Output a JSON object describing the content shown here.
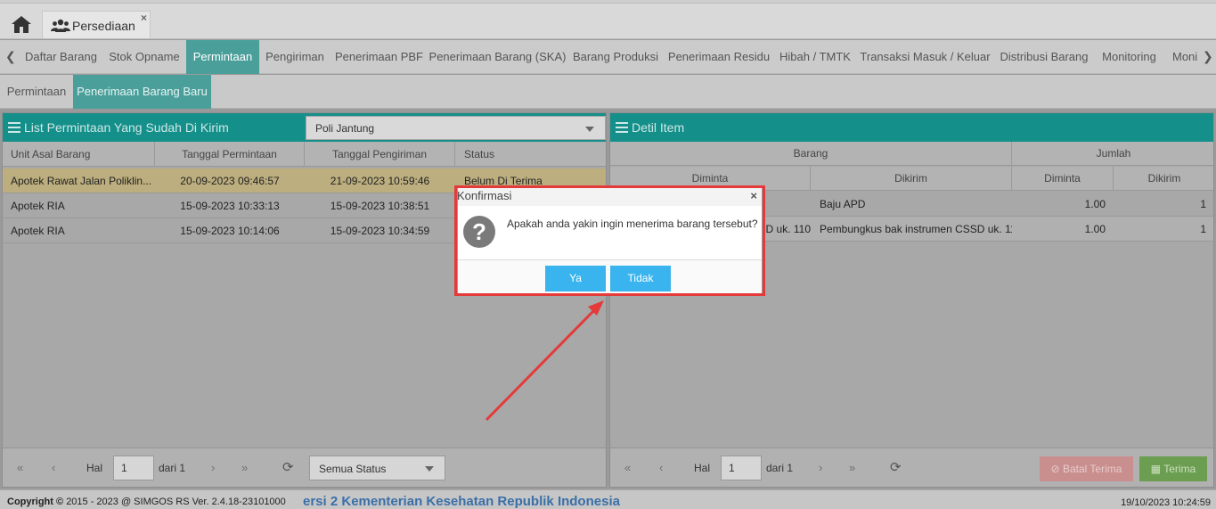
{
  "top": {
    "tab_label": "Persediaan",
    "tab_close": "×"
  },
  "modules": [
    "Daftar Barang",
    "Stok Opname",
    "Permintaan",
    "Pengiriman",
    "Penerimaan PBF",
    "Penerimaan Barang (SKA)",
    "Barang Produksi",
    "Penerimaan Residu",
    "Hibah / TMTK",
    "Transaksi Masuk / Keluar",
    "Distribusi Barang",
    "Monitoring",
    "Moni"
  ],
  "subtabs": [
    "Permintaan",
    "Penerimaan Barang Baru"
  ],
  "left_panel": {
    "title": "List Permintaan Yang Sudah Di Kirim",
    "filter_value": "Poli Jantung",
    "columns": [
      "Unit Asal Barang",
      "Tanggal Permintaan",
      "Tanggal Pengiriman",
      "Status"
    ],
    "rows": [
      [
        "Apotek Rawat Jalan Poliklin...",
        "20-09-2023 09:46:57",
        "21-09-2023 10:59:46",
        "Belum Di Terima"
      ],
      [
        "Apotek RIA",
        "15-09-2023 10:33:13",
        "15-09-2023 10:38:51",
        ""
      ],
      [
        "Apotek RIA",
        "15-09-2023 10:14:06",
        "15-09-2023 10:34:59",
        ""
      ]
    ],
    "pager": {
      "hal": "Hal",
      "page": "1",
      "dari": "dari 1",
      "status_filter": "Semua Status"
    }
  },
  "right_panel": {
    "title": "Detil Item",
    "group_barang": "Barang",
    "group_jumlah": "Jumlah",
    "columns": [
      "Diminta",
      "Dikirim",
      "Diminta",
      "Dikirim"
    ],
    "rows": [
      [
        "",
        "Baju APD",
        "1.00",
        "1"
      ],
      [
        "SSD uk. 110",
        "Pembungkus bak instrumen CSSD uk. 110",
        "1.00",
        "1"
      ]
    ],
    "pager": {
      "hal": "Hal",
      "page": "1",
      "dari": "dari 1"
    },
    "batal_label": "Batal Terima",
    "terima_label": "Terima"
  },
  "dialog": {
    "title": "Konfirmasi",
    "close": "×",
    "message": "Apakah anda yakin ingin menerima barang tersebut?",
    "yes": "Ya",
    "no": "Tidak"
  },
  "footer": {
    "copyright_prefix": "Copyright",
    "copyright_text": "2015 - 2023 @ SIMGOS RS Ver. 2.4.18-23101000",
    "marquee": "ersi 2 Kementerian Kesehatan Republik Indonesia",
    "datetime": "19/10/2023 10:24:59"
  },
  "colors": {
    "accent": "#158f8a",
    "active_tab": "#4a9f9a",
    "dialog_button": "#39b4ee",
    "highlight": "#e43a3a"
  }
}
